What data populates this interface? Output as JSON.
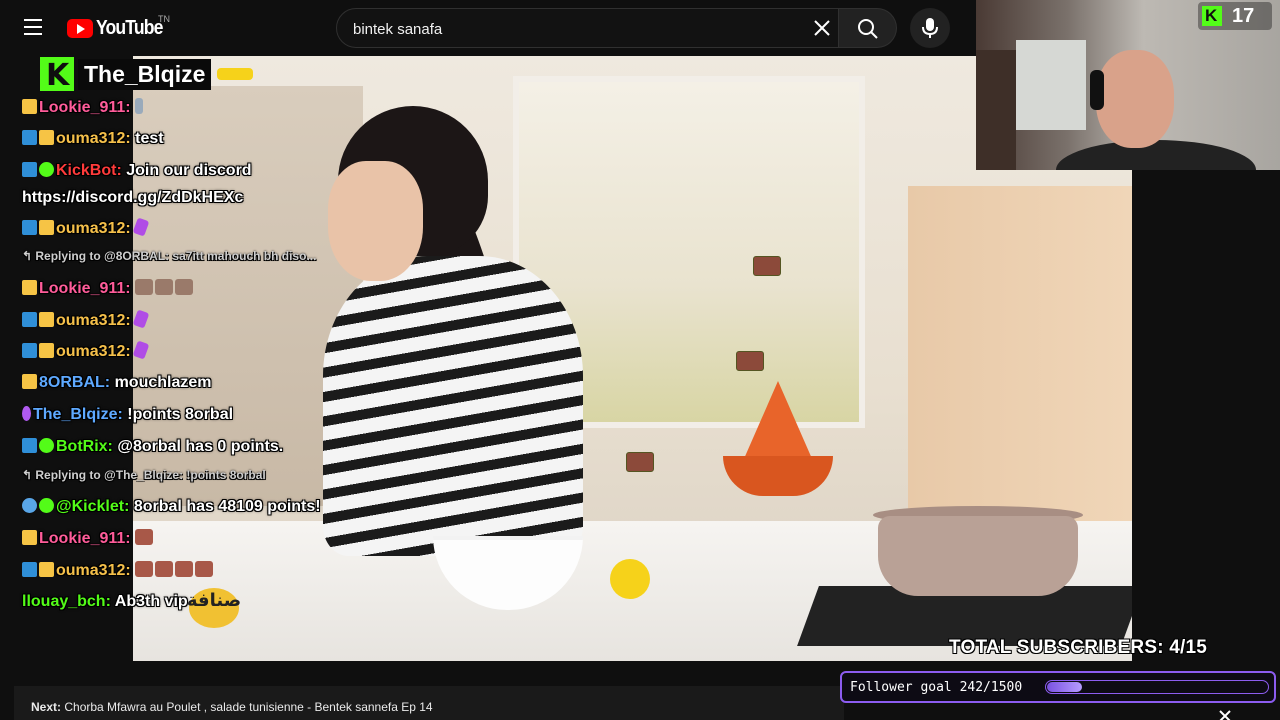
{
  "youtube": {
    "logo_text": "YouTube",
    "logo_tm": "TN",
    "search_value": "bintek sanafa"
  },
  "webcam": {
    "follower_count": "17"
  },
  "chat": {
    "channel": "The_Blqize",
    "lines": [
      {
        "user": "Lookie_911:",
        "msg": ""
      },
      {
        "user": "ouma312:",
        "msg": "test"
      },
      {
        "user": "KickBot:",
        "msg": "Join our discord",
        "cont": "https://discord.gg/ZdDkHEXc"
      },
      {
        "user": "ouma312:",
        "msg": ""
      },
      {
        "reply": "Replying to @8ORBAL: sa7itt mahouch bh diso..."
      },
      {
        "user": "Lookie_911:",
        "msg": ""
      },
      {
        "user": "ouma312:",
        "msg": ""
      },
      {
        "user": "ouma312:",
        "msg": ""
      },
      {
        "user": "8ORBAL:",
        "msg": "mouchlazem"
      },
      {
        "user": "The_Blqize:",
        "msg": "!points 8orbal"
      },
      {
        "user": "BotRix:",
        "msg": "@8orbal has 0 points."
      },
      {
        "reply": "Replying to @The_Blqize: !points 8orbal"
      },
      {
        "user": "@Kicklet:",
        "msg": "8orbal has 48109 points!"
      },
      {
        "user": "Lookie_911:",
        "msg": ""
      },
      {
        "user": "ouma312:",
        "msg": ""
      },
      {
        "user": "llouay_bch:",
        "msg": "Ab3th vip"
      }
    ]
  },
  "video": {
    "channel_logo_text": "صنافة"
  },
  "overlay": {
    "subs_label": "TOTAL SUBSCRIBERS: 4/15",
    "follower_goal_label": "Follower goal 242/1500",
    "follower_goal_fraction": 0.161
  },
  "next": {
    "label": "Next:",
    "title": "Chorba Mfawra au Poulet , salade tunisienne - Bentek sannefa Ep 14"
  },
  "colors": {
    "kick_green": "#53fc18",
    "goal_purple": "#8c5cf0",
    "yt_red": "#ff0000"
  }
}
